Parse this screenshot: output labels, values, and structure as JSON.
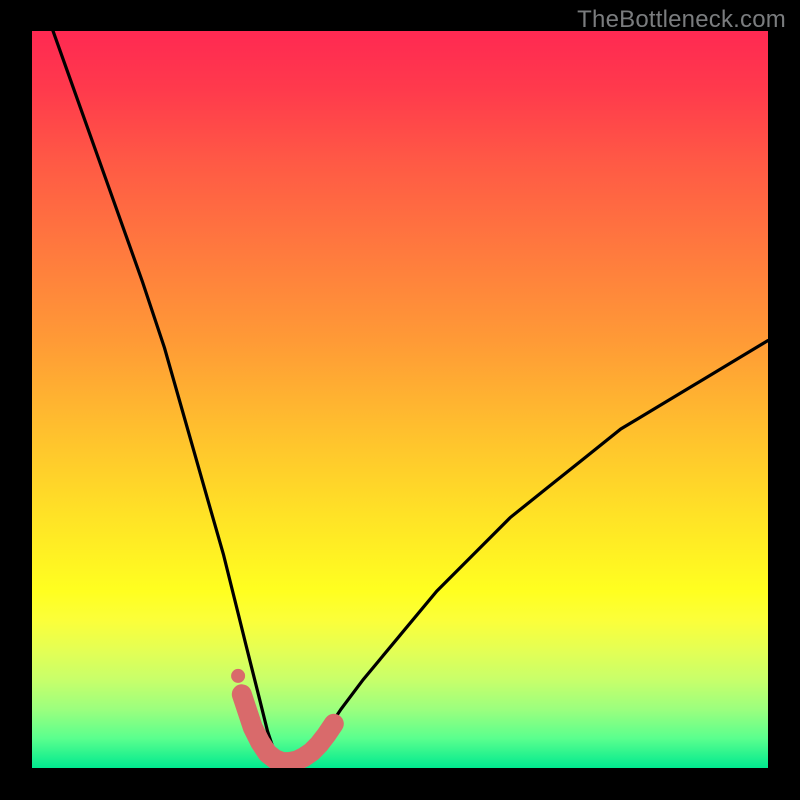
{
  "watermark": "TheBottleneck.com",
  "chart_data": {
    "type": "line",
    "title": "",
    "xlabel": "",
    "ylabel": "",
    "xlim": [
      0,
      100
    ],
    "ylim": [
      0,
      100
    ],
    "series": [
      {
        "name": "bottleneck-curve",
        "x": [
          0,
          5,
          10,
          15,
          18,
          20,
          22,
          24,
          26,
          28,
          29,
          30,
          31,
          32,
          33,
          34,
          35,
          36,
          37,
          38,
          40,
          42,
          45,
          50,
          55,
          60,
          65,
          70,
          75,
          80,
          85,
          90,
          95,
          100
        ],
        "values": [
          108,
          94,
          80,
          66,
          57,
          50,
          43,
          36,
          29,
          21,
          17,
          13,
          9,
          5,
          2,
          1,
          1,
          1,
          2,
          3,
          5,
          8,
          12,
          18,
          24,
          29,
          34,
          38,
          42,
          46,
          49,
          52,
          55,
          58
        ]
      },
      {
        "name": "highlight-band",
        "x": [
          28.5,
          30,
          31,
          32,
          33,
          34,
          35,
          36,
          37,
          38,
          39,
          40,
          41
        ],
        "values": [
          10.0,
          5.5,
          3.5,
          2.0,
          1.2,
          0.8,
          0.8,
          1.0,
          1.5,
          2.2,
          3.2,
          4.5,
          6.0
        ]
      },
      {
        "name": "highlight-dot",
        "x": [
          28.0
        ],
        "values": [
          12.5
        ]
      }
    ],
    "gradient_stops": [
      {
        "pos": 0,
        "color": "#ff2952"
      },
      {
        "pos": 18,
        "color": "#ff5a45"
      },
      {
        "pos": 42,
        "color": "#ff9a36"
      },
      {
        "pos": 66,
        "color": "#ffe326"
      },
      {
        "pos": 84,
        "color": "#e4ff54"
      },
      {
        "pos": 100,
        "color": "#00e98f"
      }
    ],
    "highlight_color": "#d96a6b",
    "curve_color": "#000000"
  }
}
